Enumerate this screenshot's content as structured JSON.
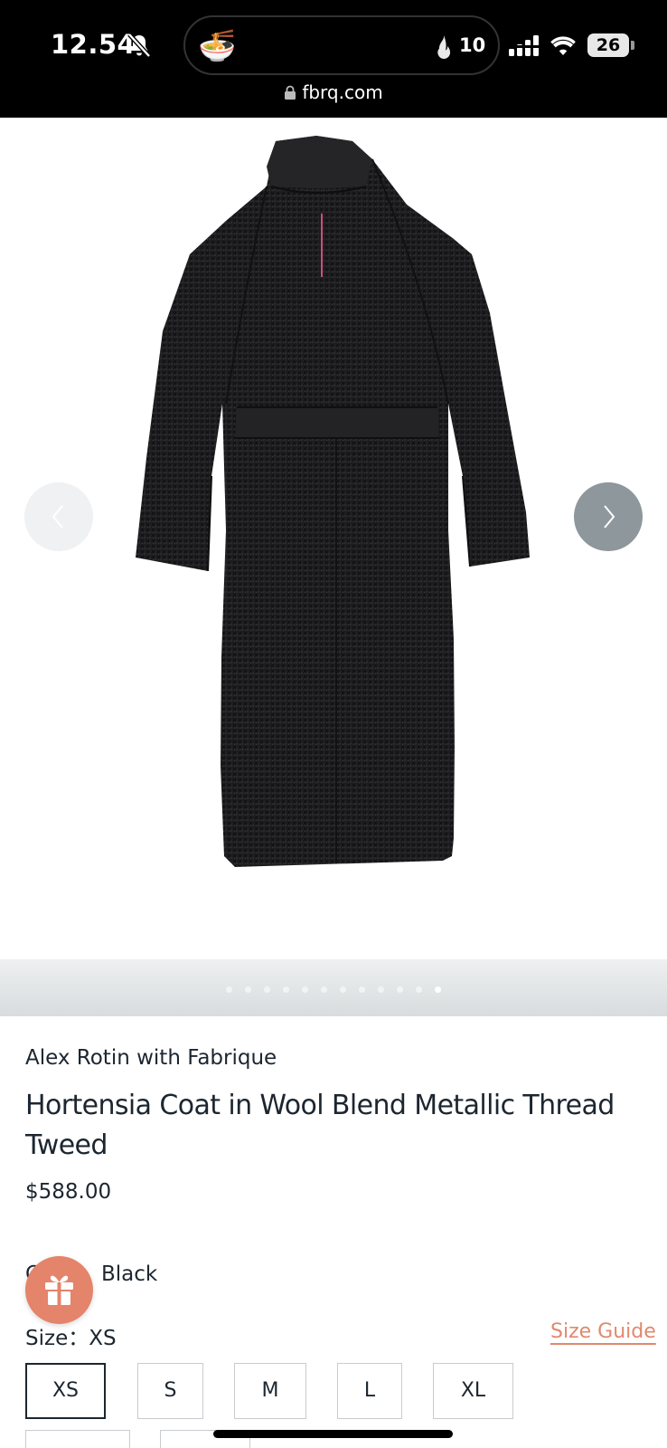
{
  "status_bar": {
    "time": "12.54",
    "island_count": "10",
    "battery_level": "26",
    "url": "fbrq.com"
  },
  "gallery": {
    "dot_count": 12,
    "active_dot": 11
  },
  "product": {
    "vendor": "Alex Rotin with Fabrique",
    "title": "Hortensia Coat in Wool Blend Metallic Thread Tweed",
    "price": "$588.00",
    "color_label": "Color:",
    "color_value": "Black",
    "size_label": "Size：",
    "size_value": "XS",
    "size_guide": "Size Guide",
    "sizes": [
      "XS",
      "S",
      "M",
      "L",
      "XL"
    ],
    "selected_size": "XS"
  },
  "colors": {
    "accent": "#e4846b",
    "size_guide": "#e0896e",
    "text": "#1c2630"
  },
  "icons": [
    "bell-slash-icon",
    "ramen-icon",
    "flame-icon",
    "signal-icon",
    "wifi-icon",
    "battery-icon",
    "lock-icon",
    "chevron-left-icon",
    "chevron-right-icon",
    "gift-icon"
  ]
}
